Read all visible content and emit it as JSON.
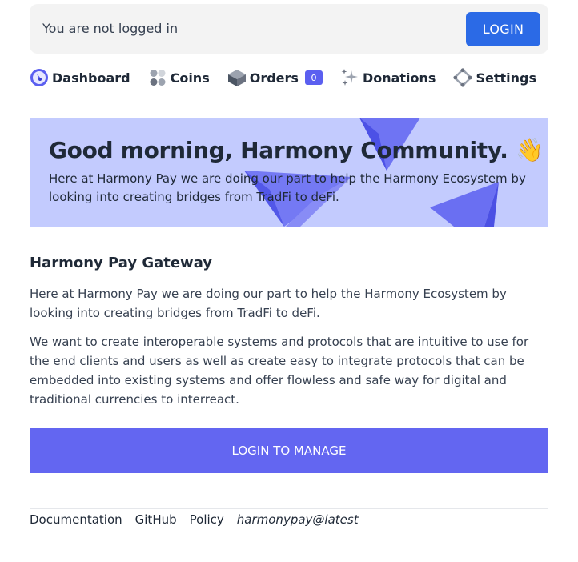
{
  "topbar": {
    "status_text": "You are not logged in",
    "login_label": "LOGIN"
  },
  "nav": {
    "items": [
      {
        "label": "Dashboard",
        "icon": "dashboard-icon"
      },
      {
        "label": "Coins",
        "icon": "coins-icon"
      },
      {
        "label": "Orders",
        "icon": "orders-icon",
        "badge": "0"
      },
      {
        "label": "Donations",
        "icon": "sparkles-icon"
      },
      {
        "label": "Settings",
        "icon": "settings-icon"
      }
    ]
  },
  "hero": {
    "title": "Good morning, Harmony Community. 👋",
    "subtitle": "Here at Harmony Pay we are doing our part to help the Harmony Ecosystem by looking into creating bridges from TradFi to deFi."
  },
  "main": {
    "heading": "Harmony Pay Gateway",
    "paragraph_1": "Here at Harmony Pay we are doing our part to help the Harmony Ecosystem by looking into creating bridges from TradFi to deFi.",
    "paragraph_2": "We want to create interoperable systems and protocols that are intuitive to use for the end clients and users as well as create easy to integrate protocols that can be embedded into existing systems and offer flowless and safe way for digital and traditional currencies to interreact.",
    "manage_label": "LOGIN TO MANAGE"
  },
  "footer": {
    "links": [
      "Documentation",
      "GitHub",
      "Policy"
    ],
    "version": "harmonypay@latest"
  },
  "colors": {
    "primary_blue": "#2b6ae6",
    "indigo": "#6366f1",
    "hero_bg": "#c3cbfe"
  }
}
